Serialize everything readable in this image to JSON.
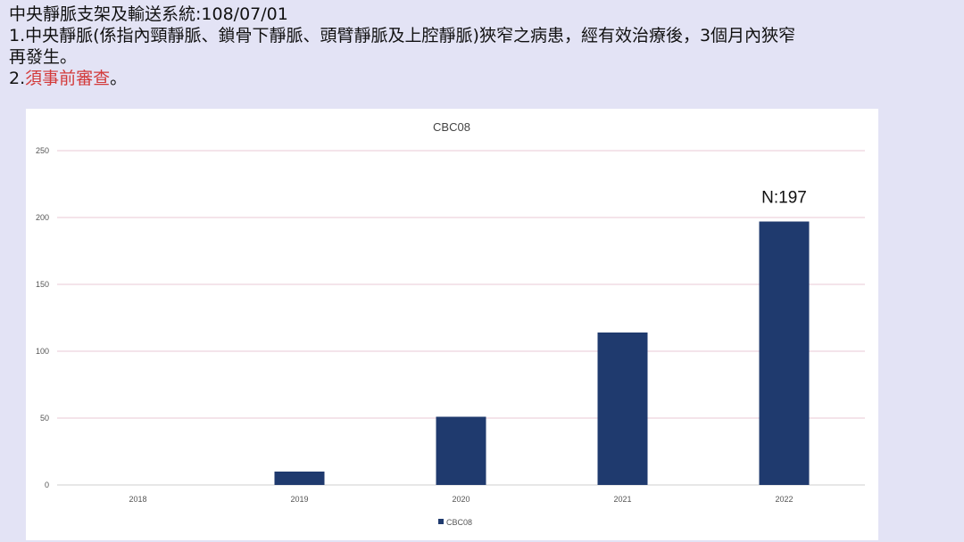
{
  "slide": {
    "heading": "中央靜脈支架及輸送系統:108/07/01",
    "item1_line1": "1.中央靜脈(係指內頸靜脈、鎖骨下靜脈、頭臂靜脈及上腔靜脈)狹窄之病患，經有效治療後，3個月內狹窄",
    "item1_line2": "再發生。",
    "item2_prefix": "2.",
    "item2_red": "須事前審查",
    "item2_suffix": "。"
  },
  "colors": {
    "bar": "#1f3a6e",
    "grid": "#e8c9d6",
    "red_text": "#d33a3a"
  },
  "chart_data": {
    "type": "bar",
    "title": "CBC08",
    "categories": [
      "2018",
      "2019",
      "2020",
      "2021",
      "2022"
    ],
    "series": [
      {
        "name": "CBC08",
        "values": [
          0,
          10,
          51,
          114,
          197
        ]
      }
    ],
    "ylim": [
      0,
      250
    ],
    "yticks": [
      "0",
      "50",
      "100",
      "150",
      "200",
      "250"
    ],
    "grid": true,
    "legend": "bottom",
    "annotation": {
      "text": "N:197",
      "category": "2022"
    }
  }
}
